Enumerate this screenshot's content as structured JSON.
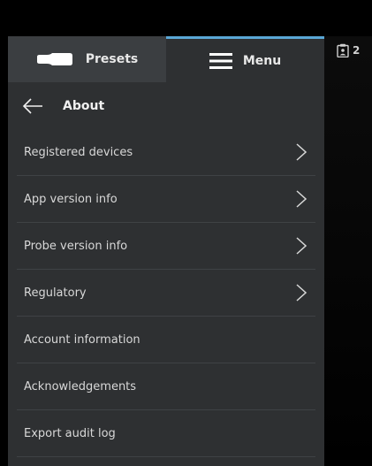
{
  "tabs": {
    "presets_label": "Presets",
    "menu_label": "Menu",
    "active": "Menu"
  },
  "header": {
    "title": "About"
  },
  "menu_items": [
    {
      "label": "Registered devices",
      "has_submenu": true
    },
    {
      "label": "App version info",
      "has_submenu": true
    },
    {
      "label": "Probe version info",
      "has_submenu": true
    },
    {
      "label": "Regulatory",
      "has_submenu": true
    },
    {
      "label": "Account information",
      "has_submenu": false
    },
    {
      "label": "Acknowledgements",
      "has_submenu": false
    },
    {
      "label": "Export audit log",
      "has_submenu": false
    }
  ],
  "clipboard_badge": {
    "count": "2"
  },
  "colors": {
    "panel_bg": "#2e3032",
    "presets_tab_bg": "#3b3e41",
    "active_tab_accent": "#5aa7d6",
    "text": "#d8d8d8"
  }
}
